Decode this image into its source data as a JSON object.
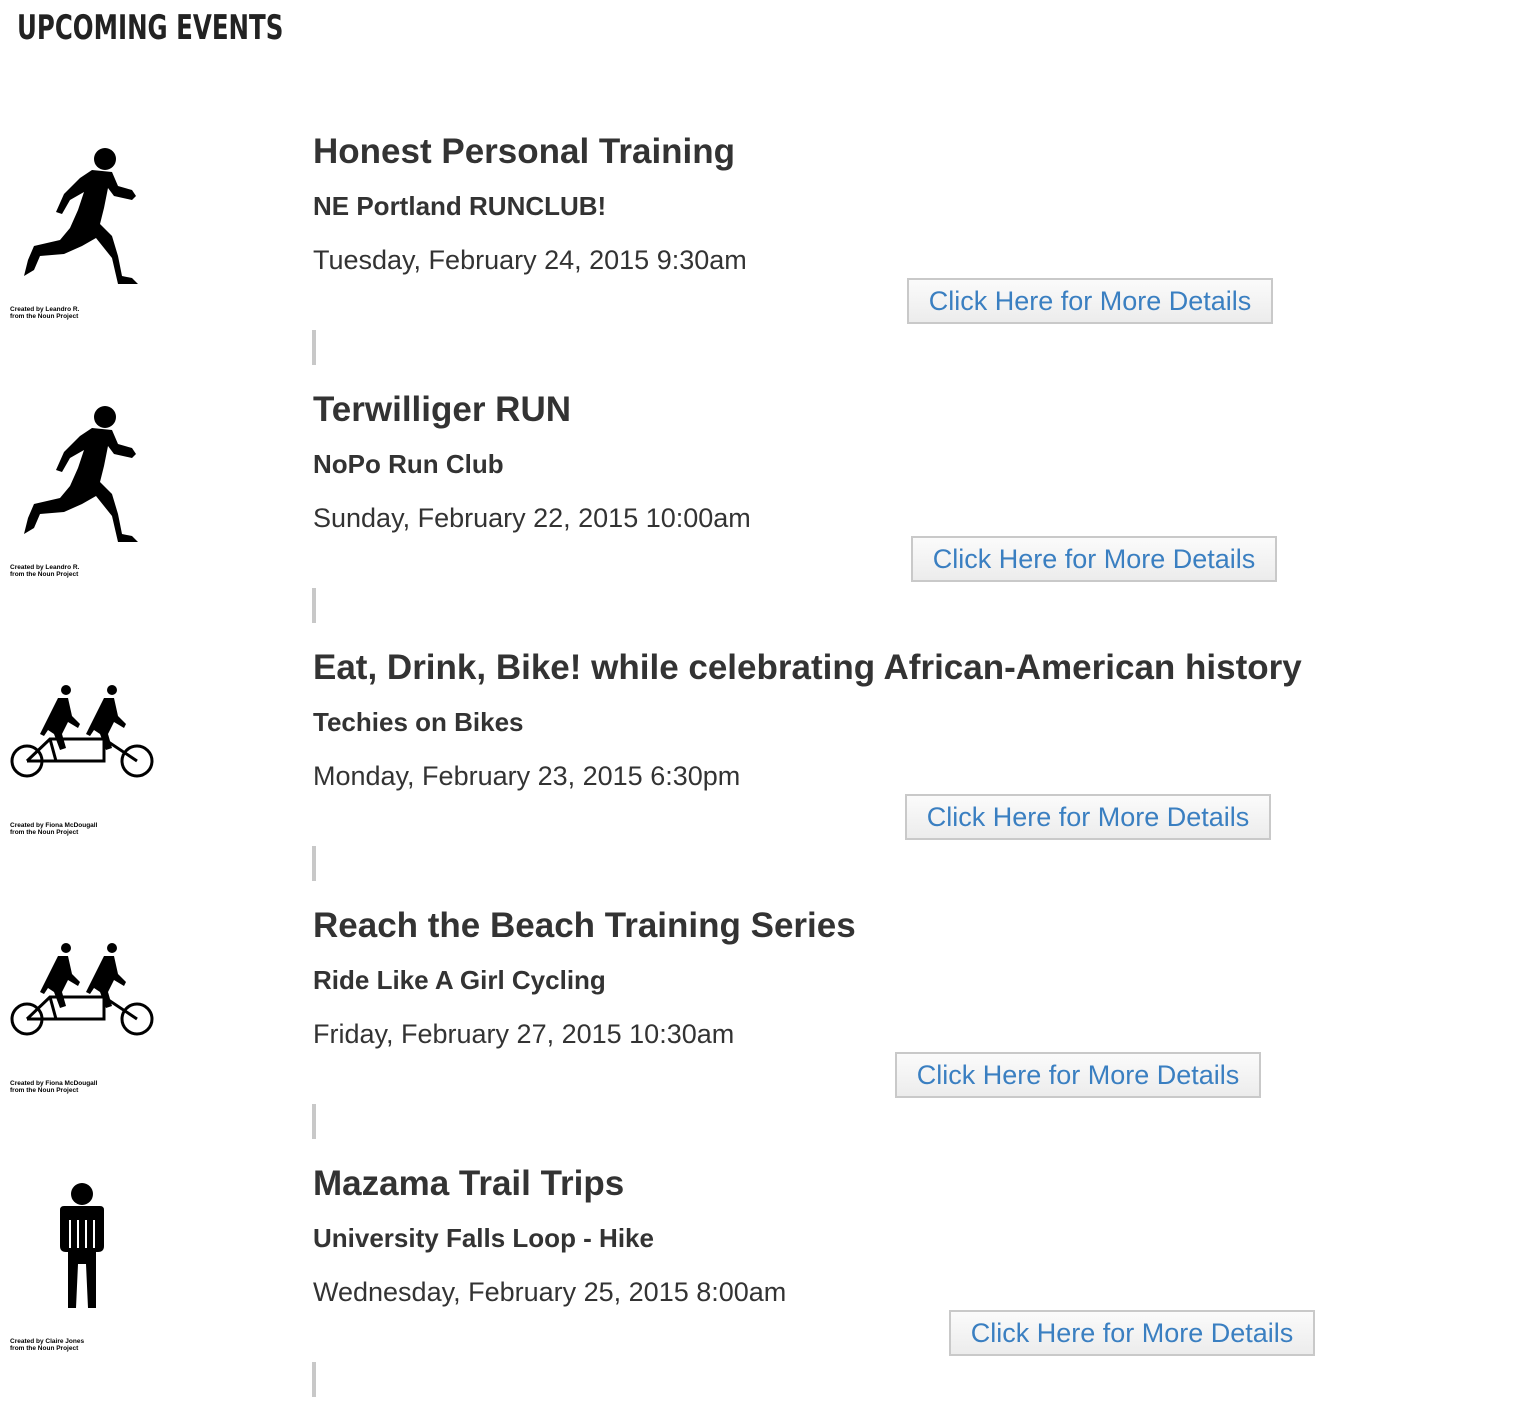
{
  "page": {
    "heading": "UPCOMING EVENTS"
  },
  "events": [
    {
      "title": "Honest Personal Training",
      "organizer": "NE Portland RUNCLUB!",
      "datetime": "Tuesday, February 24, 2015 9:30am",
      "button_label": "Click Here for More Details",
      "icon": "runner-icon",
      "credit_line1": "Created by Leandro R.",
      "credit_line2": "from the Noun Project"
    },
    {
      "title": "Terwilliger RUN",
      "organizer": "NoPo Run Club",
      "datetime": "Sunday, February 22, 2015 10:00am",
      "button_label": "Click Here for More Details",
      "icon": "runner-icon",
      "credit_line1": "Created by Leandro R.",
      "credit_line2": "from the Noun Project"
    },
    {
      "title": "Eat, Drink, Bike! while celebrating African-American history",
      "organizer": "Techies on Bikes",
      "datetime": "Monday, February 23, 2015 6:30pm",
      "button_label": "Click Here for More Details",
      "icon": "tandem-bicycle-icon",
      "credit_line1": "Created by Fiona McDougall",
      "credit_line2": "from the Noun Project"
    },
    {
      "title": "Reach the Beach Training Series",
      "organizer": "Ride Like A Girl Cycling",
      "datetime": "Friday, February 27, 2015 10:30am",
      "button_label": "Click Here for More Details",
      "icon": "tandem-bicycle-icon",
      "credit_line1": "Created by Fiona McDougall",
      "credit_line2": "from the Noun Project"
    },
    {
      "title": "Mazama Trail Trips",
      "organizer": "University Falls Loop - Hike",
      "datetime": "Wednesday, February 25, 2015 8:00am",
      "button_label": "Click Here for More Details",
      "icon": "hiker-icon",
      "credit_line1": "Created by Claire Jones",
      "credit_line2": "from the Noun Project"
    }
  ],
  "colors": {
    "text": "#333333",
    "link": "#3a7fc1",
    "divider": "#c8c8c8"
  }
}
